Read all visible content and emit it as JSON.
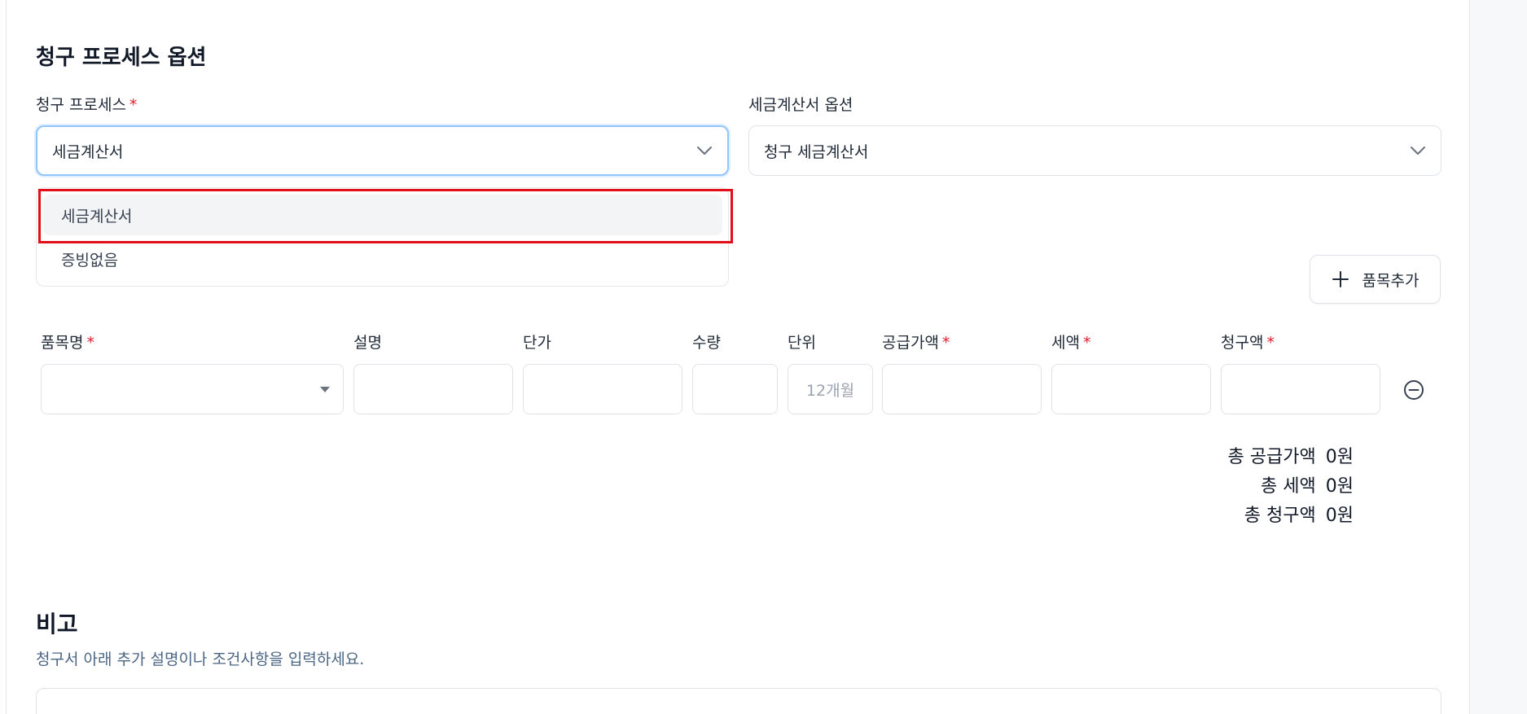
{
  "billing_section": {
    "title": "청구 프로세스 옵션",
    "process_label": "청구 프로세스",
    "process_required": "*",
    "process_value": "세금계산서",
    "tax_option_label": "세금계산서 옵션",
    "tax_option_value": "청구 세금계산서"
  },
  "process_dropdown": {
    "options": [
      "세금계산서",
      "증빙없음"
    ],
    "selected": "세금계산서"
  },
  "add_item_button": {
    "label": "품목추가",
    "icon": "plus-icon"
  },
  "items_table": {
    "columns": [
      {
        "label": "품목명",
        "required": "*"
      },
      {
        "label": "설명",
        "required": ""
      },
      {
        "label": "단가",
        "required": ""
      },
      {
        "label": "수량",
        "required": ""
      },
      {
        "label": "단위",
        "required": ""
      },
      {
        "label": "공급가액",
        "required": "*"
      },
      {
        "label": "세액",
        "required": "*"
      },
      {
        "label": "청구액",
        "required": "*"
      }
    ],
    "row": {
      "item_name": "",
      "description": "",
      "unit_price": "",
      "quantity": "",
      "unit_placeholder": "12개월",
      "supply_amount": "",
      "tax": "",
      "billing_amount": ""
    }
  },
  "totals": {
    "supply_label": "총 공급가액",
    "supply_value": "0원",
    "tax_label": "총 세액",
    "tax_value": "0원",
    "billing_label": "총 청구액",
    "billing_value": "0원"
  },
  "notes_section": {
    "title": "비고",
    "subtitle": "청구서 아래 추가 설명이나 조건사항을 입력하세요."
  },
  "colors": {
    "required": "#e11d2e",
    "highlight": "#e00f1a",
    "focus": "#93c5fd",
    "subtitle": "#4b6584"
  }
}
